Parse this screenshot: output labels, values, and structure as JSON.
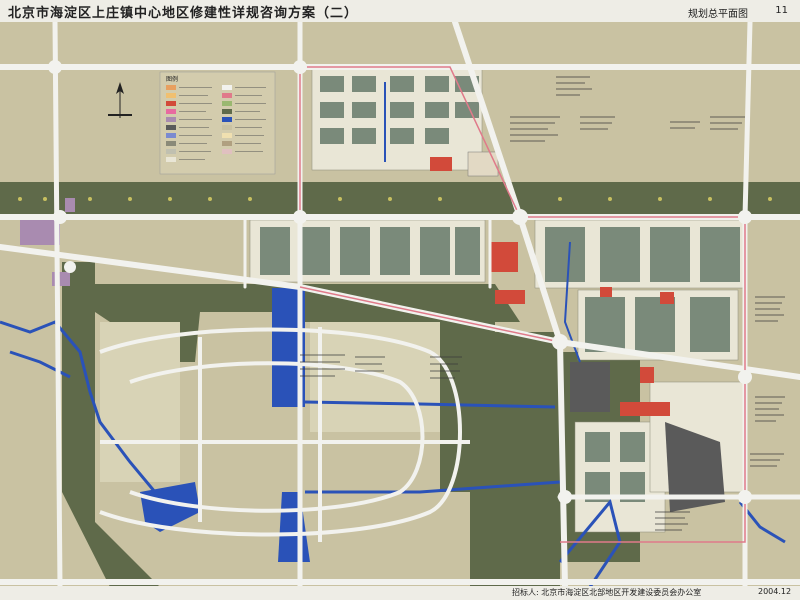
{
  "header": {
    "title": "北京市海淀区上庄镇中心地区修建性详规咨询方案（二）",
    "sheet_name": "规划总平面图",
    "sheet_number": "11"
  },
  "footer": {
    "organization": "招标人: 北京市海淀区北部地区开发建设委员会办公室",
    "date": "2004.12"
  },
  "legend": {
    "title": "图例"
  },
  "colors": {
    "background": "#c9c2a2",
    "green_belt": "#5f6a4a",
    "road": "#f2f2ee",
    "water": "#2a52b8",
    "red_road_edge": "#e07a8a",
    "building_red": "#d24a3a"
  }
}
